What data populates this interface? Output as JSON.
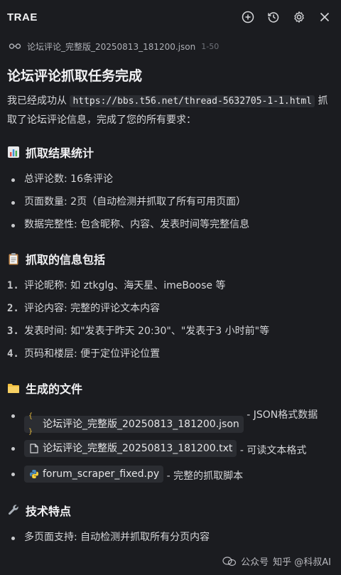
{
  "header": {
    "title": "TRAE",
    "icons": [
      "add-chat-icon",
      "history-icon",
      "gear-icon",
      "close-icon"
    ]
  },
  "ref": {
    "filename": "论坛评论_完整版_20250813_181200.json",
    "range": "1-50"
  },
  "main": {
    "title": "论坛评论抓取任务完成",
    "intro_prefix": "我已经成功从 ",
    "intro_url": "https://bbs.t56.net/thread-5632705-1-1.html",
    "intro_suffix": " 抓取了论坛评论信息，完成了您的所有要求："
  },
  "stats": {
    "heading": "抓取结果统计",
    "items": [
      "总评论数: 16条评论",
      "页面数量: 2页（自动检测并抓取了所有可用页面）",
      "数据完整性: 包含昵称、内容、发表时间等完整信息"
    ]
  },
  "info": {
    "heading": "抓取的信息包括",
    "items": [
      {
        "num": "1.",
        "text": "评论昵称: 如 ztkglg、海天星、imeBoose 等"
      },
      {
        "num": "2.",
        "text": "评论内容: 完整的评论文本内容"
      },
      {
        "num": "3.",
        "text": "发表时间: 如\"发表于昨天 20:30\"、\"发表于3 小时前\"等"
      },
      {
        "num": "4.",
        "text": "页码和楼层: 便于定位评论位置"
      }
    ]
  },
  "files": {
    "heading": "生成的文件",
    "items": [
      {
        "icon": "{ }",
        "name": "论坛评论_完整版_20250813_181200.json",
        "desc": " - JSON格式数据"
      },
      {
        "icon": "txt",
        "name": "论坛评论_完整版_20250813_181200.txt",
        "desc": " - 可读文本格式"
      },
      {
        "icon": "py",
        "name": "forum_scraper_fixed.py",
        "desc": " - 完整的抓取脚本"
      }
    ]
  },
  "tech": {
    "heading": "技术特点",
    "items": [
      "多页面支持: 自动检测并抓取所有分页内容"
    ]
  },
  "watermark": {
    "text": "知乎 @科叔AI",
    "brand": "公众号"
  },
  "colors": {
    "background": "#1b1c20",
    "text": "#d6d7da",
    "code_bg": "#2b2d32",
    "python_blue": "#4b8bbe",
    "json_yellow": "#e5b93c",
    "folder_yellow": "#f2c040"
  }
}
